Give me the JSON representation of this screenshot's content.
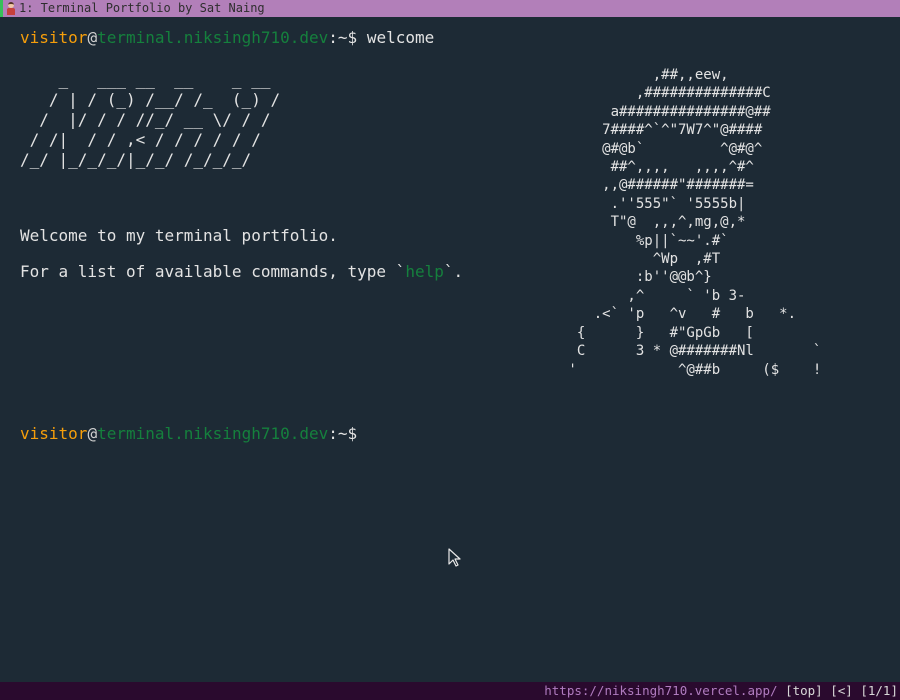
{
  "window": {
    "title": "1: Terminal Portfolio by Sat Naing",
    "favicon": "avatar-favicon-icon"
  },
  "prompt": {
    "user": "visitor",
    "at": "@",
    "host": "terminal.niksingh710.dev",
    "path": ":~$"
  },
  "history": [
    {
      "command": "welcome"
    }
  ],
  "welcome": {
    "logo_ascii": "    _   ___ __  __    _ __\n   / | / (_) /__/ /_  (_) /\n  /  |/ / / //_/ __ \\/ / /\n / /|  / / ,< / / / / / /\n/_/ |_/_/_/|_/_/ /_/_/_/",
    "art_ascii": "           ,##,,eew,\n         ,##############C\n      a###############@##\n     7####^`^\"7W7^\"@####\n     @#@b`         ^@#@^\n      ##^,,,,   ,,,,^#^\n     ,,@######\"#######=\n      .''555\"` '5555b|\n      T\"@  ,,,^,mg,@,*\n         %p||`~~'.#`\n           ^Wp  ,#T\n         :b''@@b^}\n        ,^     ` 'b 3-\n    .<` 'p   ^v   #   b   *.\n  {      }   #\"GpGb   [\n  C      3 * @#######Nl       `\n '            ^@##b     ($    !",
    "intro": "Welcome to my terminal portfolio.",
    "help_prefix": "For a list of available commands, type `",
    "help_command": "help",
    "help_suffix": "`."
  },
  "statusbar": {
    "url": "https://niksingh710.vercel.app/",
    "position": "[top]",
    "history_flag": "[<]",
    "page_count": "[1/1]"
  },
  "colors": {
    "background": "#1d2a35",
    "prompt_user": "#f59e0b",
    "prompt_host": "#15803d",
    "titlebar": "#b27fb9",
    "statusbar": "#2a0a2e"
  }
}
